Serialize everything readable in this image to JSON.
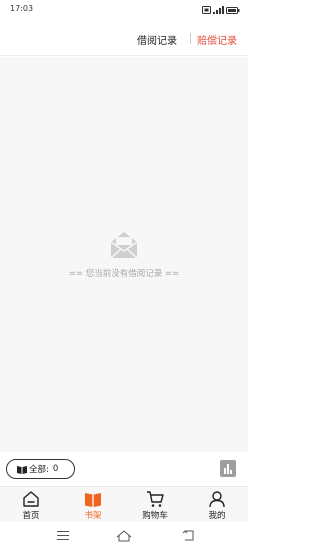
{
  "status_bar": {
    "time": "17:03"
  },
  "header": {
    "tabs": [
      {
        "label": "借阅记录",
        "active": false
      },
      {
        "label": "赔偿记录",
        "active": true
      }
    ]
  },
  "main": {
    "empty_text": "== 您当前没有借阅记录 =="
  },
  "summary": {
    "total_label": "全部:",
    "total_count": "0"
  },
  "tabbar": {
    "items": [
      {
        "label": "首页",
        "icon": "home-icon",
        "active": false
      },
      {
        "label": "书架",
        "icon": "bookshelf-icon",
        "active": true
      },
      {
        "label": "购物车",
        "icon": "cart-icon",
        "active": false
      },
      {
        "label": "我的",
        "icon": "user-icon",
        "active": false
      }
    ]
  },
  "nav_bar": {
    "icons": [
      "menu-icon",
      "home-nav-icon",
      "back-icon"
    ]
  },
  "colors": {
    "accent": "#f0641e",
    "compensate_tab": "#e64b3c"
  }
}
